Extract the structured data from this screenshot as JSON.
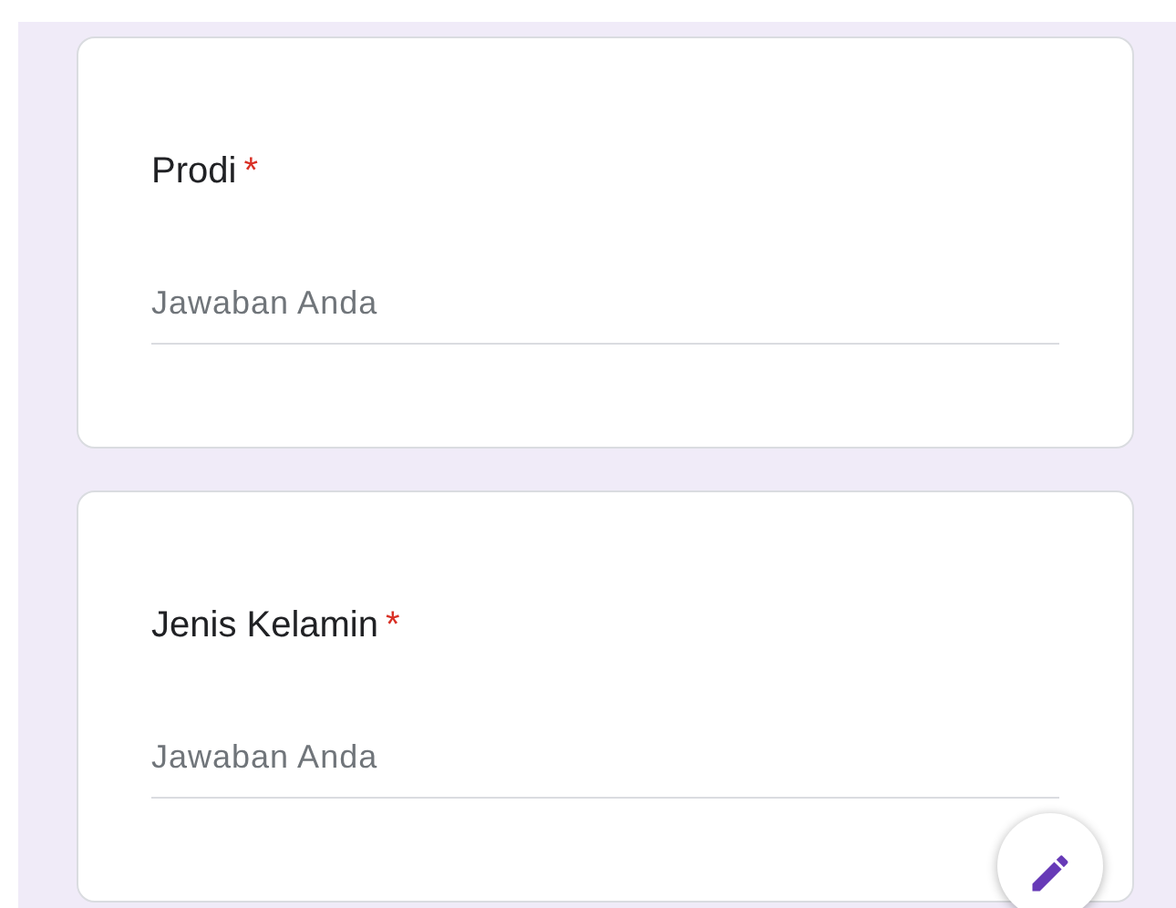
{
  "questions": [
    {
      "title": "Prodi",
      "required_mark": "*",
      "placeholder": "Jawaban Anda"
    },
    {
      "title": "Jenis Kelamin",
      "required_mark": "*",
      "placeholder": "Jawaban Anda"
    }
  ]
}
